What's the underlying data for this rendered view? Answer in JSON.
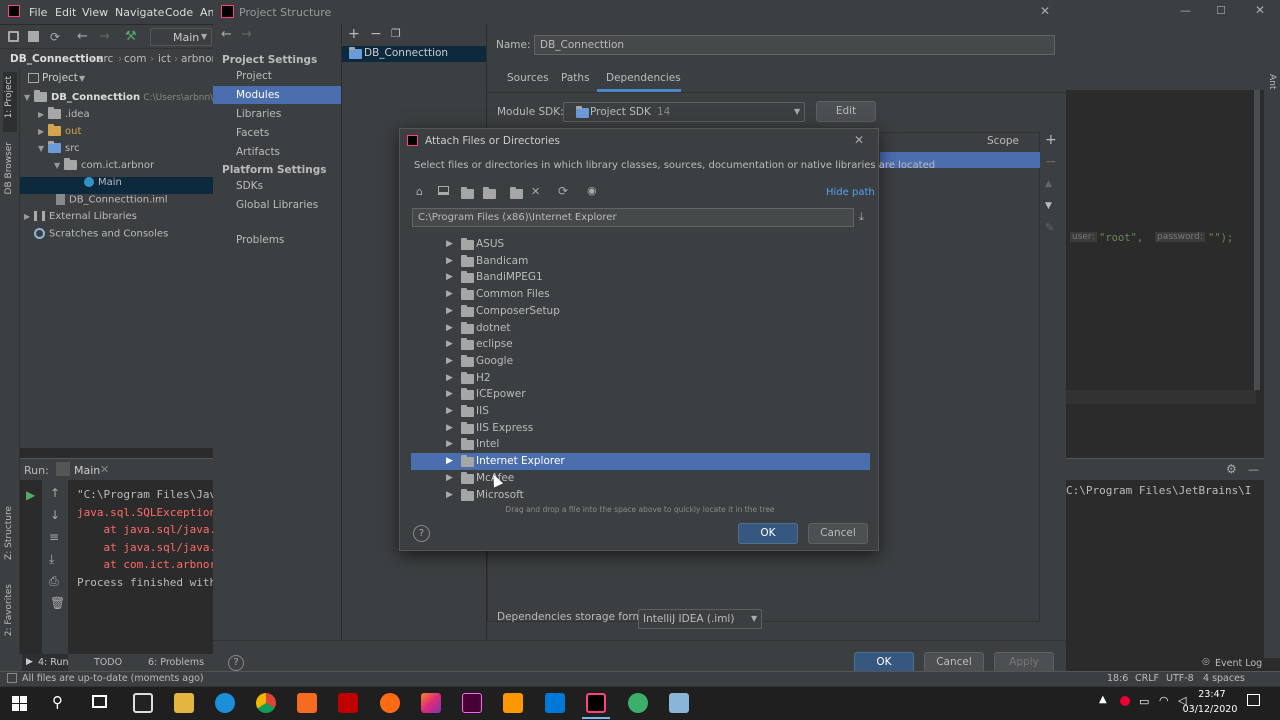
{
  "menu": {
    "file": "File",
    "edit": "Edit",
    "view": "View",
    "navigate": "Navigate",
    "code": "Code",
    "analyze": "An"
  },
  "toolbar": {
    "run_config": "Main"
  },
  "breadcrumb": {
    "project": "DB_Connecttion",
    "src": "src",
    "com": "com",
    "ict": "ict",
    "arbnor": "arbnor"
  },
  "project_panel": {
    "title": "Project",
    "tree": [
      {
        "label": "DB_Connecttion",
        "path": "C:\\Users\\arbnn\\Id"
      },
      {
        "label": ".idea"
      },
      {
        "label": "out"
      },
      {
        "label": "src"
      },
      {
        "label": "com.ict.arbnor"
      },
      {
        "label": "Main"
      },
      {
        "label": "DB_Connecttion.iml"
      },
      {
        "label": "External Libraries"
      },
      {
        "label": "Scratches and Consoles"
      }
    ]
  },
  "left_strip": {
    "project": "1: Project",
    "db": "DB Browser",
    "structure": "Z: Structure",
    "favorites": "2: Favorites"
  },
  "run_panel": {
    "label": "Run:",
    "tab": "Main",
    "lines": [
      "\"C:\\Program Files\\Jav",
      "java.sql.SQLException",
      "    at java.sql/java.",
      "    at java.sql/java.",
      "    at com.ict.arbnor",
      "",
      "Process finished with"
    ]
  },
  "bottom_tabs": {
    "run": "4: Run",
    "todo": "TODO",
    "problems": "6: Problems"
  },
  "status": {
    "message": "All files are up-to-date (moments ago)",
    "pos": "18:6",
    "crlf": "CRLF",
    "enc": "UTF-8",
    "indent": "4 spaces",
    "event_log": "Event Log"
  },
  "editor_right": {
    "line_count": "1",
    "code_user": "user:",
    "code_root": "\"root\",",
    "code_pass": "password:",
    "code_end": "\"\");",
    "console": "C:\\Program Files\\JetBrains\\I",
    "ant": "Ant"
  },
  "project_structure": {
    "title": "Project Structure",
    "project_settings": "Project Settings",
    "nav1": [
      "Project",
      "Modules",
      "Libraries",
      "Facets",
      "Artifacts"
    ],
    "platform_settings": "Platform Settings",
    "nav2": [
      "SDKs",
      "Global Libraries"
    ],
    "problems": "Problems",
    "module": "DB_Connecttion",
    "name_label": "Name:",
    "name_value": "DB_Connecttion",
    "tabs": [
      "Sources",
      "Paths",
      "Dependencies"
    ],
    "sdk_label": "Module SDK:",
    "sdk_value": "Project SDK",
    "sdk_version": "14",
    "edit": "Edit",
    "scope": "Scope",
    "storage_label": "Dependencies storage format:",
    "storage_value": "IntelliJ IDEA (.iml)",
    "ok": "OK",
    "cancel": "Cancel",
    "apply": "Apply"
  },
  "attach": {
    "title": "Attach Files or Directories",
    "desc": "Select files or directories in which library classes, sources, documentation or native libraries are located",
    "hide_path": "Hide path",
    "path": "C:\\Program Files (x86)\\Internet Explorer",
    "folders": [
      "ASUS",
      "Bandicam",
      "BandiMPEG1",
      "Common Files",
      "ComposerSetup",
      "dotnet",
      "eclipse",
      "Google",
      "H2",
      "ICEpower",
      "IIS",
      "IIS Express",
      "Intel",
      "Internet Explorer",
      "McAfee",
      "Microsoft"
    ],
    "selected": "Internet Explorer",
    "hint": "Drag and drop a file into the space above to quickly locate it in the tree",
    "ok": "OK",
    "cancel": "Cancel"
  },
  "taskbar": {
    "time": "23:47",
    "date": "03/12/2020"
  },
  "colors": {
    "selection": "#4b6eaf",
    "default_button": "#365880",
    "panel": "#3c3f41",
    "editor": "#2b2b2b"
  }
}
